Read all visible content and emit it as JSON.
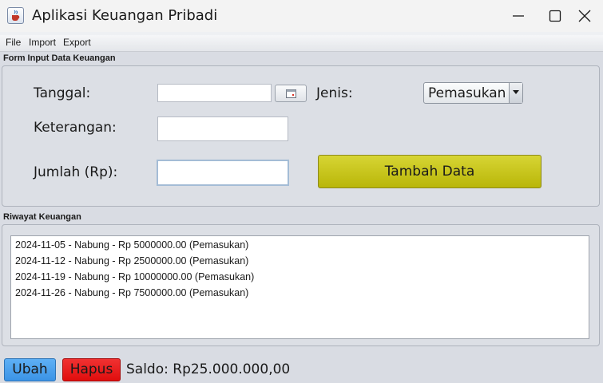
{
  "window": {
    "title": "Aplikasi Keuangan Pribadi",
    "icon": "java-cup-icon",
    "controls": [
      "minimize-icon",
      "maximize-icon",
      "close-icon"
    ]
  },
  "menu": {
    "items": [
      "File",
      "Import",
      "Export"
    ]
  },
  "form": {
    "group_title": "Form Input Data Keuangan",
    "date_label": "Tanggal:",
    "date_value": "",
    "date_picker_icon": "calendar-icon",
    "type_label": "Jenis:",
    "type_selected": "Pemasukan",
    "description_label": "Keterangan:",
    "description_value": "",
    "amount_label": "Jumlah (Rp):",
    "amount_value": "",
    "add_button": "Tambah Data"
  },
  "history": {
    "group_title": "Riwayat Keuangan",
    "entries": [
      "2024-11-05 - Nabung - Rp 5000000.00 (Pemasukan)",
      "2024-11-12 - Nabung - Rp 2500000.00 (Pemasukan)",
      "2024-11-19 - Nabung - Rp 10000000.00 (Pemasukan)",
      "2024-11-26 - Nabung - Rp 7500000.00 (Pemasukan)"
    ]
  },
  "footer": {
    "edit_button": "Ubah",
    "delete_button": "Hapus",
    "balance_text": "Saldo: Rp25.000.000,00"
  },
  "colors": {
    "add_button": "#c9c71d",
    "edit_button": "#4aa3f0",
    "delete_button": "#ec1c1c",
    "panel_background": "#dcdfe5"
  }
}
